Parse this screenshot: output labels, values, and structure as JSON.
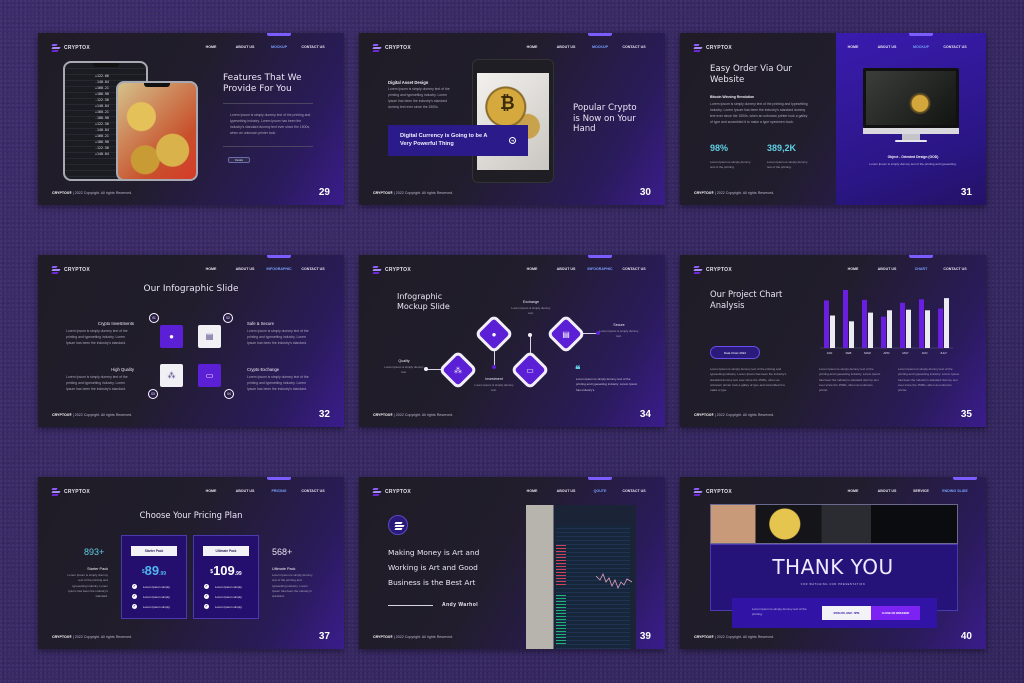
{
  "brand": "CRYPTOX",
  "footer": {
    "brand": "CRYPTOX®",
    "copyright": " | 2022 Copyright. All rights Reserved."
  },
  "lorem_short": "Lorem Ipsum is simply dummy text of the printing and typesetting industry. Lorem Ipsum has been the industry's standard dummy text ever since the 1500s, when an unknown printer took a galley.",
  "slides": [
    {
      "page": "29",
      "nav": [
        "HOME",
        "ABOUT US",
        "MOCKUP",
        "CONTACT US"
      ],
      "active": 2,
      "title": "Features That We Provide For You",
      "body": "Lorem Ipsum is simply dummy text of the printing and typesetting industry. Lorem Ipsum has been the industry's standard dummy text ever since the 1500s, when an unknown printer took.",
      "button": "Details",
      "ticker": [
        "+122.06",
        "-140.04",
        "+160.21",
        "+180.90",
        "-122.56",
        "+140.04",
        "+160.21",
        "-180.90",
        "+122.56",
        "-140.04",
        "+160.21",
        "+180.90",
        "-122.56",
        "+140.04"
      ]
    },
    {
      "page": "30",
      "nav": [
        "HOME",
        "ABOUT US",
        "MOCKUP",
        "CONTACT US"
      ],
      "active": 2,
      "subtitle": "Digital Asset Design",
      "body": "Lorem Ipsum is simply dummy text of the printing and typesetting industry. Lorem Ipsum has been the industry's standard dummy text ever since the 1500s.",
      "callout": "Digital Currency is Going to be A Very Powerful Thing",
      "title": "Popular Crypto is Now on Your Hand"
    },
    {
      "page": "31",
      "nav": [
        "HOME",
        "ABOUT US",
        "MOCKUP",
        "CONTACT US"
      ],
      "active": 2,
      "title": "Easy Order Via Our Website",
      "subtitle": "Bitcoin Winning Revolution",
      "body": "Lorem Ipsum is simply dummy text of the printing and typesetting industry. Lorem Ipsum has been the industry's standard dummy text ever since the 1500s, when an unknown printer took a galley of type and scrambled it to make a type specimen book.",
      "stats": [
        {
          "value": "98%",
          "desc": "Lorem Ipsum is simply dummy text of the printing."
        },
        {
          "value": "389,2K",
          "desc": "Lorem Ipsum is simply dummy text of the printing."
        }
      ],
      "caption": "Object - Oriented Design (OOD)",
      "caption_body": "Lorem Ipsum is simply dummy text of the printing and typesetting."
    },
    {
      "page": "32",
      "nav": [
        "HOME",
        "ABOUT US",
        "INFOGRAPHIC",
        "CONTACT US"
      ],
      "active": 2,
      "title": "Our Infographic Slide",
      "items": [
        {
          "num": "01",
          "label": "Crypto Investments",
          "icon": "piggy-bank-icon",
          "glyph": "🐖",
          "body": "Lorem Ipsum is simply dummy text of the printing and typesetting industry. Lorem Ipsum has been the industry's standard."
        },
        {
          "num": "02",
          "label": "Safe & Secure",
          "icon": "money-icon",
          "glyph": "💵",
          "body": "Lorem Ipsum is simply dummy text of the printing and typesetting industry. Lorem Ipsum has been the industry's standard."
        },
        {
          "num": "03",
          "label": "High Quality",
          "icon": "network-icon",
          "glyph": "⛬",
          "body": "Lorem Ipsum is simply dummy text of the printing and typesetting industry. Lorem Ipsum has been the industry's standard."
        },
        {
          "num": "04",
          "label": "Crypto Exchange",
          "icon": "wallet-icon",
          "glyph": "▭",
          "body": "Lorem Ipsum is simply dummy text of the printing and typesetting industry. Lorem Ipsum has been the industry's standard."
        }
      ]
    },
    {
      "page": "34",
      "nav": [
        "HOME",
        "ABOUT US",
        "INFOGRAPHIC",
        "CONTACT US"
      ],
      "active": 2,
      "title": "Infographic Mockup Slide",
      "items": [
        {
          "label": "Quality",
          "body": "Lorem Ipsum is simply dummy text."
        },
        {
          "label": "Investment",
          "body": "Lorem Ipsum is simply dummy text."
        },
        {
          "label": "Exchange",
          "body": "Lorem Ipsum is simply dummy text."
        },
        {
          "label": "Secure",
          "body": "Lorem Ipsum is simply dummy text."
        }
      ],
      "quote_mark": "❝",
      "quote": "Lorem Ipsum is simply dummy text of the printing and typesetting industry. Lorem Ipsum has industry's."
    },
    {
      "page": "35",
      "nav": [
        "HOME",
        "ABOUT US",
        "CHART",
        "CONTACT US"
      ],
      "active": 2,
      "title": "Our Project Chart Analysis",
      "button": "Data Chart 2022",
      "columns": [
        "Lorem Ipsum is simply dummy text of the printing and typesetting industry. Lorem Ipsum has been the industry's standard dummy text ever since the 1500s, when an unknown printer took a galley of type and scrambled it to make a type.",
        "Lorem Ipsum is simply dummy text of the printing and typesetting industry. Lorem Ipsum has been the industry's standard dummy text ever since the 1500s, when an unknown printer.",
        "Lorem Ipsum is simply dummy text of the printing and typesetting industry. Lorem Ipsum has been the industry's standard dummy text ever since the 1500s, when an unknown printer."
      ]
    },
    {
      "page": "37",
      "nav": [
        "HOME",
        "ABOUT US",
        "PRICING",
        "CONTACT US"
      ],
      "active": 2,
      "title": "Choose Your Pricing Plan",
      "left": {
        "count": "893+",
        "name": "Starter Pack",
        "body": "Lorem Ipsum is simply dummy text of the printing and typesetting industry. Lorem Ipsum has been the industry's standard."
      },
      "right": {
        "count": "568+",
        "name": "Ultimate Pack",
        "body": "Lorem Ipsum is simply dummy text of the printing and typesetting industry. Lorem Ipsum has been the industry's standard."
      },
      "plans": [
        {
          "name": "Starter Pack",
          "currency": "$",
          "price": "89",
          "cents": ".99",
          "features": [
            "Lorem Ipsum simply",
            "Lorem Ipsum simply",
            "Lorem Ipsum simply"
          ],
          "price_color": "#4fb6f0"
        },
        {
          "name": "Ultimate Pack",
          "currency": "$",
          "price": "109",
          "cents": ".99",
          "features": [
            "Lorem Ipsum simply",
            "Lorem Ipsum simply",
            "Lorem Ipsum simply"
          ],
          "price_color": "#ffffff"
        }
      ]
    },
    {
      "page": "39",
      "nav": [
        "HOME",
        "ABOUT US",
        "QOUTE",
        "CONTACT US"
      ],
      "active": 2,
      "quote": "Making Money is Art and Working is Art and Good Business is the Best Art",
      "author": "Andy Warhol"
    },
    {
      "page": "40",
      "nav": [
        "HOME",
        "ABOUT US",
        "SERVICE",
        "ENDING SLIDE"
      ],
      "active": 3,
      "title": "THANK YOU",
      "subtitle": "FOR WATCHING OUR PRESENTATION",
      "body": "Lorem Ipsum is simply dummy text of the printing.",
      "hours": "MON-FRI, 8AM - 5PM",
      "closed": "CLOSE ON WEEKEND"
    }
  ],
  "chart_data": {
    "type": "bar",
    "title": "Our Project Chart Analysis",
    "categories": [
      "JAN",
      "FEB",
      "MAR",
      "APR",
      "MAY",
      "JUN",
      "JULY"
    ],
    "series": [
      {
        "name": "Series 1",
        "color": "#6a1ee0",
        "values": [
          82,
          100,
          83,
          54,
          78,
          84,
          68
        ]
      },
      {
        "name": "Series 2",
        "color": "#ecebf2",
        "values": [
          56,
          46,
          61,
          65,
          66,
          65,
          86
        ]
      }
    ],
    "ylim": [
      0,
      100
    ],
    "grid": false,
    "legend": "none",
    "xlabel": "",
    "ylabel": ""
  },
  "colors": {
    "accent": "#5b1fd6",
    "cyan": "#5fd0e5",
    "nav_active": "#7aa2ff",
    "background": "#3a2a66"
  }
}
